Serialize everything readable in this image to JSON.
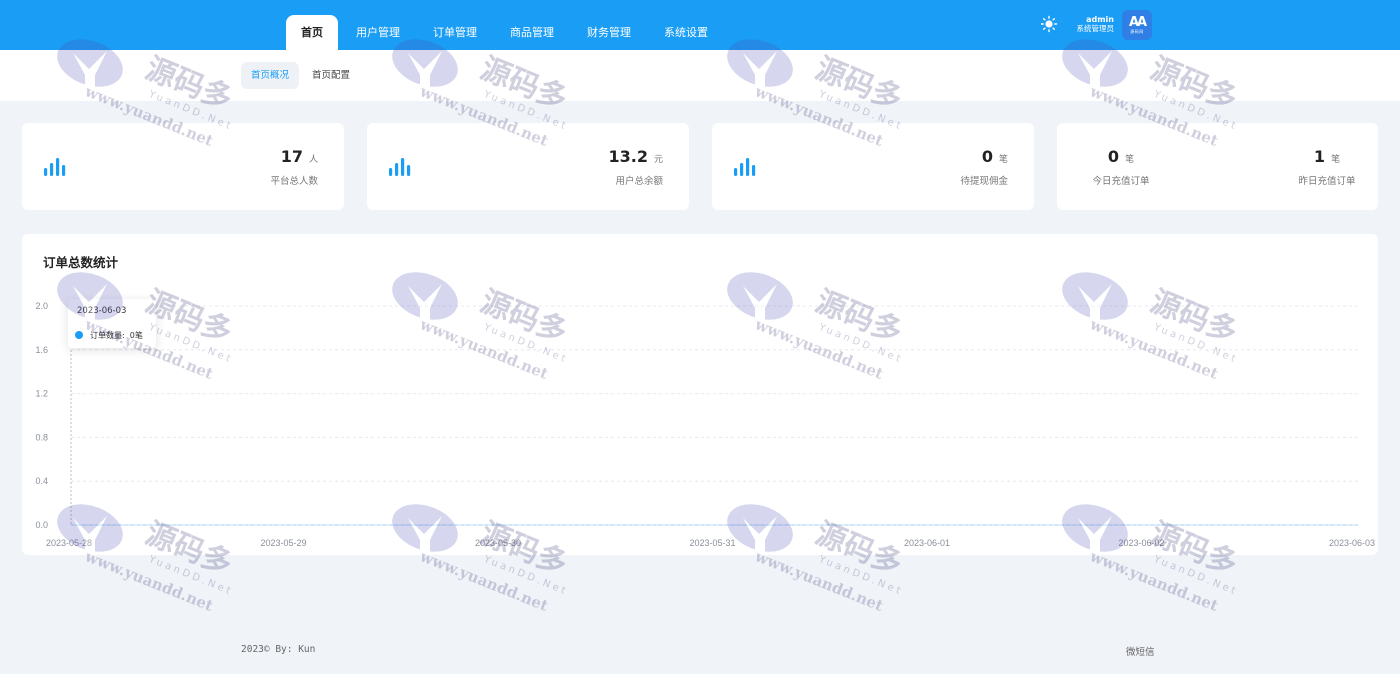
{
  "topbar": {
    "nav": [
      {
        "label": "首页",
        "active": true
      },
      {
        "label": "用户管理",
        "active": false
      },
      {
        "label": "订单管理",
        "active": false
      },
      {
        "label": "商品管理",
        "active": false
      },
      {
        "label": "财务管理",
        "active": false
      },
      {
        "label": "系统设置",
        "active": false
      }
    ],
    "theme_icon": "sun-icon",
    "user": {
      "name": "admin",
      "role": "系统管理员"
    },
    "avatar_logo": "AA",
    "avatar_text": "源码网",
    "color": "#1a9df5"
  },
  "subbar": {
    "tabs": [
      {
        "label": "首页概况",
        "active": true
      },
      {
        "label": "首页配置",
        "active": false
      }
    ]
  },
  "stats": [
    {
      "value": "17",
      "unit": "人",
      "label": "平台总人数"
    },
    {
      "value": "13.2",
      "unit": "元",
      "label": "用户总余额"
    },
    {
      "value": "0",
      "unit": "笔",
      "label": "待提现佣金"
    },
    {
      "value": "0",
      "unit": "笔",
      "label": "今日充值订单"
    },
    {
      "value": "1",
      "unit": "笔",
      "label": "昨日充值订单"
    }
  ],
  "chart": {
    "title": "订单总数统计",
    "tooltip": {
      "date": "2023-06-03",
      "series": "订单数量:",
      "value": "0笔"
    }
  },
  "chart_data": {
    "type": "line",
    "title": "订单总数统计",
    "x": [
      "2023-05-28",
      "2023-05-29",
      "2023-05-30",
      "2023-05-31",
      "2023-06-01",
      "2023-06-02",
      "2023-06-03"
    ],
    "series": [
      {
        "name": "订单数量",
        "values": [
          0,
          0,
          0,
          0,
          0,
          0,
          0
        ]
      }
    ],
    "yticks": [
      "0.0",
      "0.4",
      "0.8",
      "1.2",
      "1.6",
      "2.0"
    ],
    "ylim": [
      0,
      2
    ],
    "grid": true,
    "color": "#1a9df5"
  },
  "footer": {
    "left": "2023© By: Kun",
    "right": "微短信"
  },
  "watermark": {
    "big": "源码多",
    "mid": "YuanDD.Net",
    "small": "www.yuandd.net"
  }
}
